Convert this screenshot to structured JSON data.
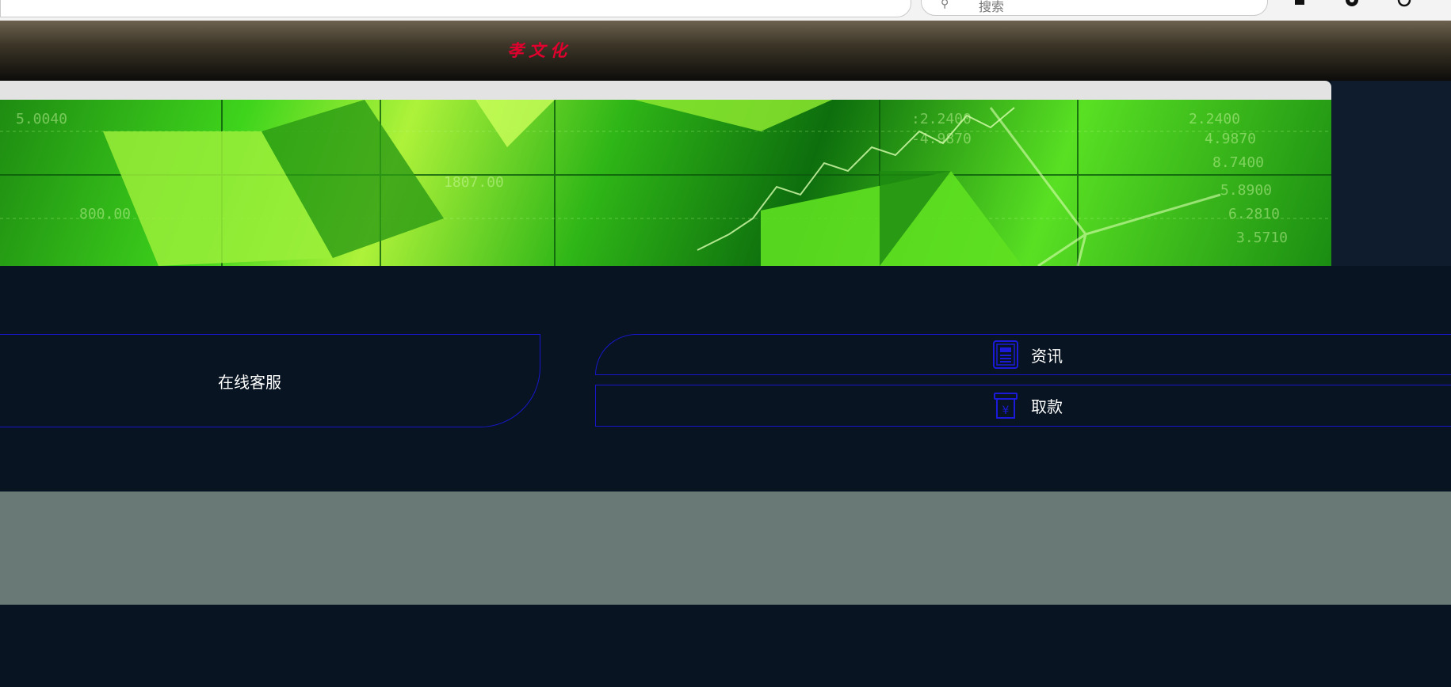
{
  "browser": {
    "search_placeholder": "搜索",
    "icons": [
      "refresh-icon",
      "read-aloud-icon",
      "favorite-icon",
      "search-icon",
      "extensions-icon",
      "profile-icon",
      "settings-icon"
    ]
  },
  "header": {
    "logo_text": "孝文化",
    "logo_color": "#e0002e"
  },
  "banner": {
    "description_icon": "stock-chart-banner"
  },
  "main": {
    "service_label": "在线客服",
    "menu": [
      {
        "label": "资讯",
        "icon": "news-icon"
      },
      {
        "label": "取款",
        "icon": "withdraw-icon"
      }
    ]
  },
  "colors": {
    "page_bg": "#081422",
    "border_accent": "#1717c9",
    "gray_band": "#687976"
  }
}
